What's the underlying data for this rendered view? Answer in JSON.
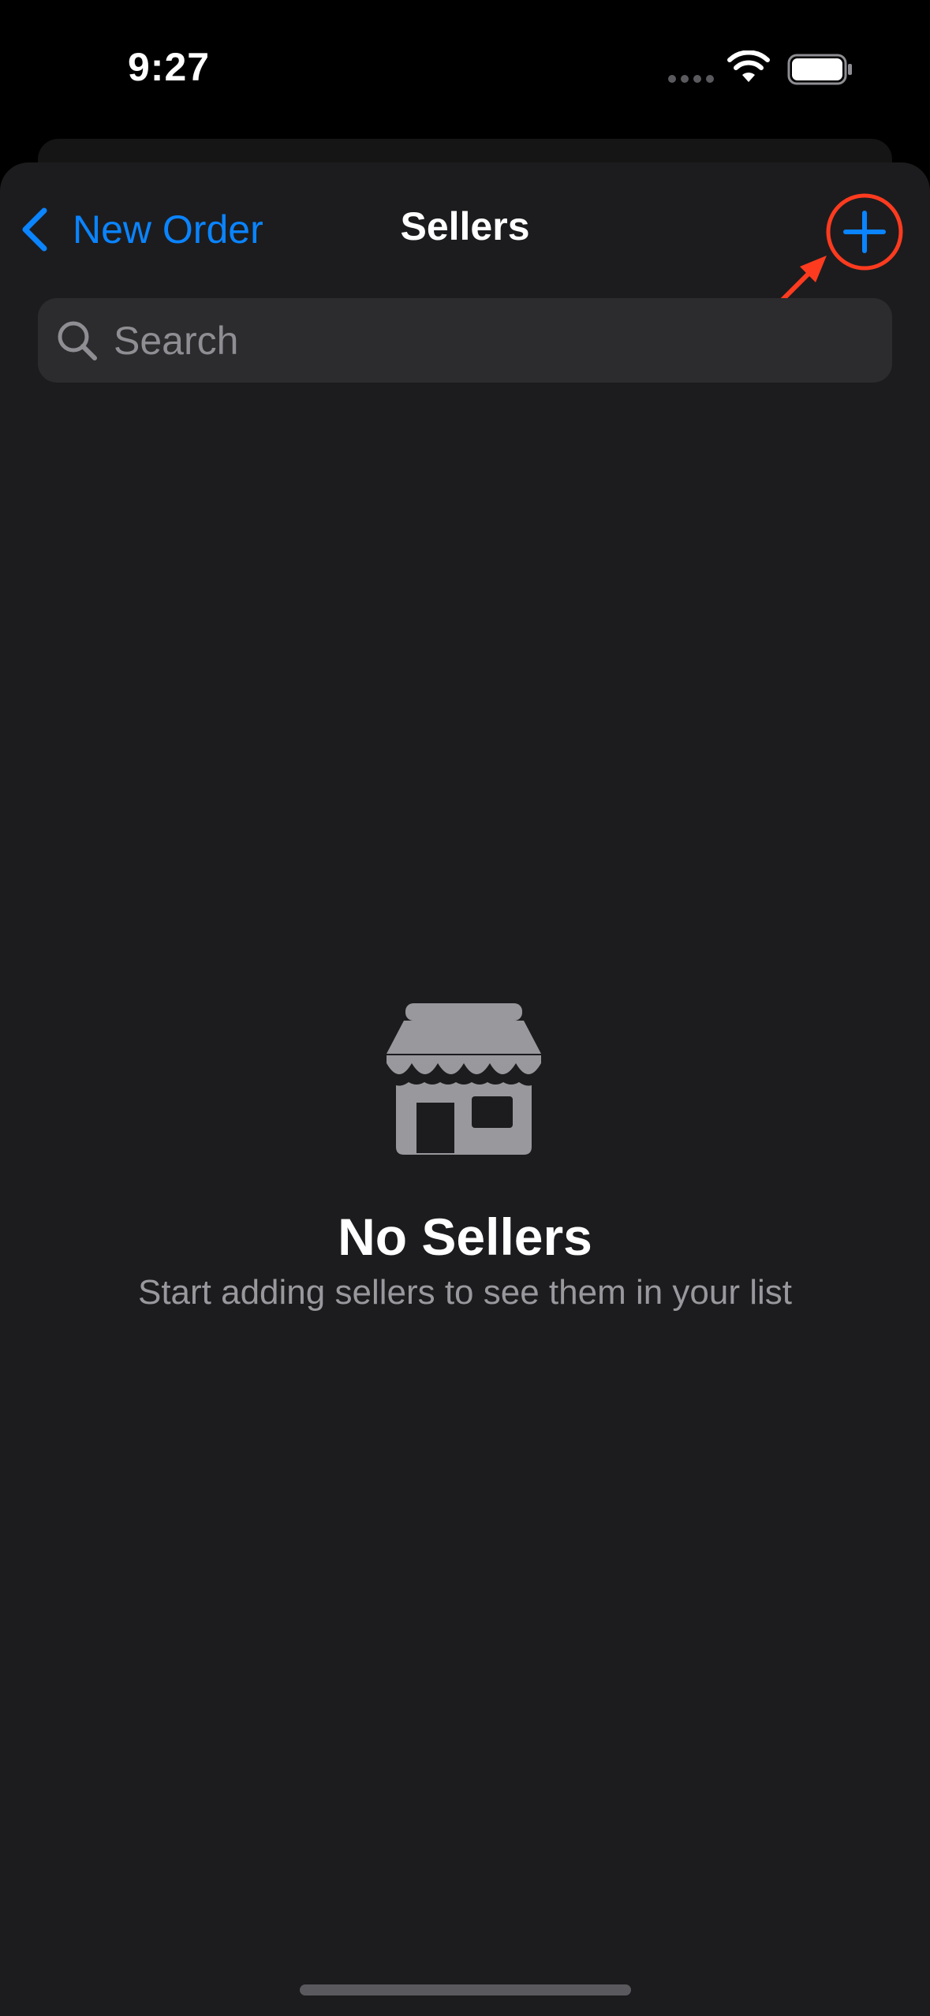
{
  "status_bar": {
    "time": "9:27",
    "cellular_icon": "cellular-dots-icon",
    "wifi_icon": "wifi-icon",
    "battery_icon": "battery-icon"
  },
  "nav": {
    "back_label": "New Order",
    "back_icon": "chevron-left-icon",
    "title": "Sellers",
    "add_icon": "plus-icon"
  },
  "search": {
    "placeholder": "Search",
    "icon": "magnifying-glass-icon"
  },
  "empty_state": {
    "icon": "storefront-icon",
    "title": "No Sellers",
    "subtitle": "Start adding sellers to see them in your list"
  },
  "colors": {
    "accent": "#0a84ff",
    "background": "#1c1c1e",
    "annotation": "#ff3b1f"
  }
}
